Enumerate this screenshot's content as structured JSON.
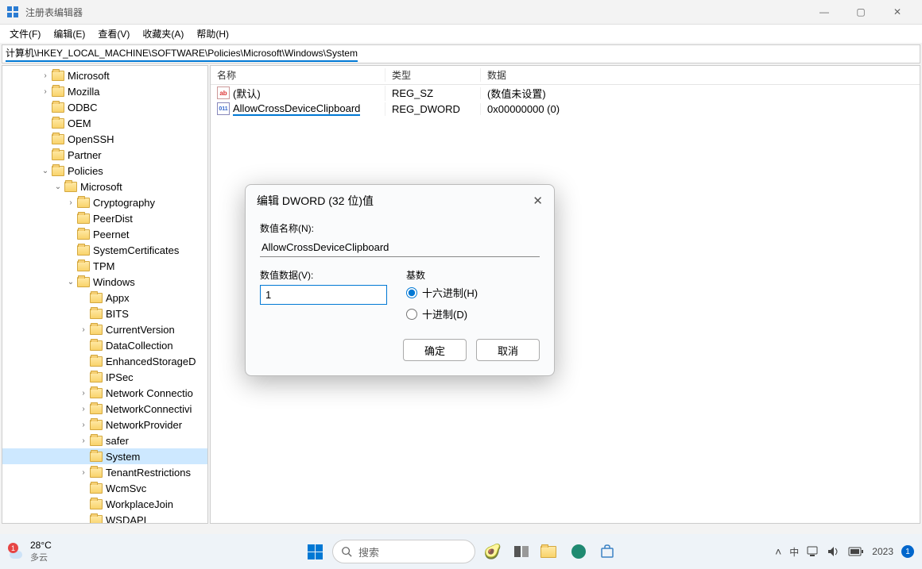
{
  "window": {
    "title": "注册表编辑器"
  },
  "menu": {
    "file": "文件(F)",
    "edit": "编辑(E)",
    "view": "查看(V)",
    "favorites": "收藏夹(A)",
    "help": "帮助(H)"
  },
  "address": {
    "path": "计算机\\HKEY_LOCAL_MACHINE\\SOFTWARE\\Policies\\Microsoft\\Windows\\System"
  },
  "tree": {
    "nodes": [
      {
        "depth": 3,
        "chev": "right",
        "icon": "closed",
        "label": "Microsoft"
      },
      {
        "depth": 3,
        "chev": "right",
        "icon": "closed",
        "label": "Mozilla"
      },
      {
        "depth": 3,
        "chev": "none",
        "icon": "closed",
        "label": "ODBC"
      },
      {
        "depth": 3,
        "chev": "none",
        "icon": "closed",
        "label": "OEM"
      },
      {
        "depth": 3,
        "chev": "none",
        "icon": "closed",
        "label": "OpenSSH"
      },
      {
        "depth": 3,
        "chev": "none",
        "icon": "closed",
        "label": "Partner"
      },
      {
        "depth": 3,
        "chev": "down",
        "icon": "open",
        "label": "Policies"
      },
      {
        "depth": 4,
        "chev": "down",
        "icon": "open",
        "label": "Microsoft"
      },
      {
        "depth": 5,
        "chev": "right",
        "icon": "closed",
        "label": "Cryptography"
      },
      {
        "depth": 5,
        "chev": "none",
        "icon": "closed",
        "label": "PeerDist"
      },
      {
        "depth": 5,
        "chev": "none",
        "icon": "closed",
        "label": "Peernet"
      },
      {
        "depth": 5,
        "chev": "none",
        "icon": "closed",
        "label": "SystemCertificates"
      },
      {
        "depth": 5,
        "chev": "none",
        "icon": "closed",
        "label": "TPM"
      },
      {
        "depth": 5,
        "chev": "down",
        "icon": "open",
        "label": "Windows"
      },
      {
        "depth": 6,
        "chev": "none",
        "icon": "closed",
        "label": "Appx"
      },
      {
        "depth": 6,
        "chev": "none",
        "icon": "closed",
        "label": "BITS"
      },
      {
        "depth": 6,
        "chev": "right",
        "icon": "closed",
        "label": "CurrentVersion"
      },
      {
        "depth": 6,
        "chev": "none",
        "icon": "closed",
        "label": "DataCollection"
      },
      {
        "depth": 6,
        "chev": "none",
        "icon": "closed",
        "label": "EnhancedStorageD"
      },
      {
        "depth": 6,
        "chev": "none",
        "icon": "closed",
        "label": "IPSec"
      },
      {
        "depth": 6,
        "chev": "right",
        "icon": "closed",
        "label": "Network Connectio"
      },
      {
        "depth": 6,
        "chev": "right",
        "icon": "closed",
        "label": "NetworkConnectivi"
      },
      {
        "depth": 6,
        "chev": "right",
        "icon": "closed",
        "label": "NetworkProvider"
      },
      {
        "depth": 6,
        "chev": "right",
        "icon": "closed",
        "label": "safer"
      },
      {
        "depth": 6,
        "chev": "none",
        "icon": "open",
        "label": "System",
        "selected": true
      },
      {
        "depth": 6,
        "chev": "right",
        "icon": "closed",
        "label": "TenantRestrictions"
      },
      {
        "depth": 6,
        "chev": "none",
        "icon": "closed",
        "label": "WcmSvc"
      },
      {
        "depth": 6,
        "chev": "none",
        "icon": "closed",
        "label": "WorkplaceJoin"
      },
      {
        "depth": 6,
        "chev": "none",
        "icon": "closed",
        "label": "WSDAPI"
      }
    ]
  },
  "list": {
    "columns": {
      "name": "名称",
      "type": "类型",
      "data": "数据"
    },
    "rows": [
      {
        "icon": "str",
        "name": "(默认)",
        "type": "REG_SZ",
        "data": "(数值未设置)"
      },
      {
        "icon": "bin",
        "name": "AllowCrossDeviceClipboard",
        "underlined": true,
        "type": "REG_DWORD",
        "data": "0x00000000 (0)"
      }
    ]
  },
  "dialog": {
    "title": "编辑 DWORD (32 位)值",
    "name_label": "数值名称(N):",
    "name_value": "AllowCrossDeviceClipboard",
    "data_label": "数值数据(V):",
    "data_value": "1",
    "base_label": "基数",
    "radio_hex": "十六进制(H)",
    "radio_dec": "十进制(D)",
    "ok": "确定",
    "cancel": "取消"
  },
  "taskbar": {
    "temp": "28°C",
    "weather_desc": "多云",
    "search_placeholder": "搜索",
    "ime": "中",
    "year": "2023",
    "notif": "1"
  }
}
